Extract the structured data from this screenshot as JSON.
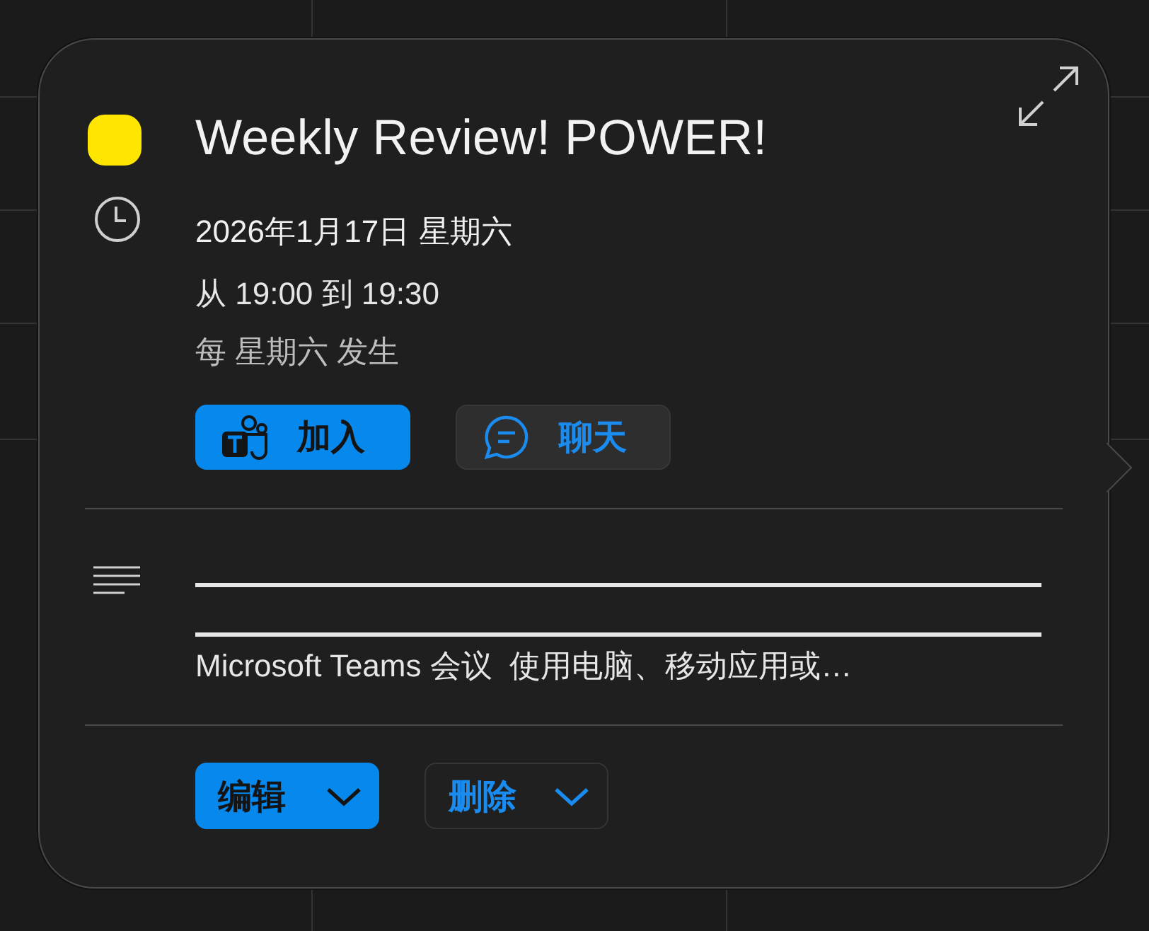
{
  "event": {
    "color": "#ffe600",
    "title": "Weekly Review! POWER!"
  },
  "schedule": {
    "date": "2026年1月17日 星期六",
    "time": "从 19:00 到 19:30",
    "recurrence": "每 星期六 发生"
  },
  "meeting_buttons": [
    {
      "kind": "teams",
      "label": "加入"
    },
    {
      "kind": "chat",
      "label": "聊天"
    }
  ],
  "description": {
    "text": "Microsoft Teams 会议  使用电脑、移动应用或…"
  },
  "actions": [
    {
      "kind": "primary",
      "label": "编辑"
    },
    {
      "kind": "secondary",
      "label": "删除"
    }
  ]
}
